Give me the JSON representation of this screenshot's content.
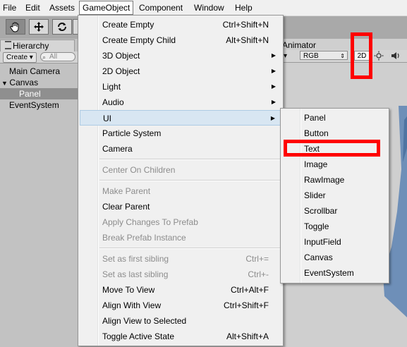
{
  "menubar": {
    "items": [
      {
        "label": "File"
      },
      {
        "label": "Edit"
      },
      {
        "label": "Assets"
      },
      {
        "label": "GameObject"
      },
      {
        "label": "Component"
      },
      {
        "label": "Window"
      },
      {
        "label": "Help"
      }
    ],
    "active": "GameObject"
  },
  "toolbar": {
    "tools": [
      {
        "icon": "hand-icon",
        "active": true
      },
      {
        "icon": "move-icon",
        "active": false
      },
      {
        "icon": "rotate-icon",
        "active": false
      }
    ]
  },
  "hierarchy": {
    "tab_label": "Hierarchy",
    "create_label": "Create ▾",
    "search_placeholder": "All",
    "items": [
      {
        "label": "Main Camera"
      },
      {
        "label": "Canvas"
      },
      {
        "label": "Panel"
      },
      {
        "label": "EventSystem"
      }
    ]
  },
  "scene": {
    "animator_tab": "Animator",
    "render_mode": "RGB",
    "mode_2d": "2D"
  },
  "gameobject_menu": {
    "items": [
      {
        "label": "Create Empty",
        "shortcut": "Ctrl+Shift+N"
      },
      {
        "label": "Create Empty Child",
        "shortcut": "Alt+Shift+N"
      },
      {
        "label": "3D Object",
        "arrow": "▶"
      },
      {
        "label": "2D Object",
        "arrow": "▶"
      },
      {
        "label": "Light",
        "arrow": "▶"
      },
      {
        "label": "Audio",
        "arrow": "▶"
      },
      {
        "label": "UI",
        "arrow": "▶"
      },
      {
        "label": "Particle System"
      },
      {
        "label": "Camera"
      },
      {
        "label": "Center On Children"
      },
      {
        "label": "Make Parent"
      },
      {
        "label": "Clear Parent"
      },
      {
        "label": "Apply Changes To Prefab"
      },
      {
        "label": "Break Prefab Instance"
      },
      {
        "label": "Set as first sibling",
        "shortcut": "Ctrl+="
      },
      {
        "label": "Set as last sibling",
        "shortcut": "Ctrl+-"
      },
      {
        "label": "Move To View",
        "shortcut": "Ctrl+Alt+F"
      },
      {
        "label": "Align With View",
        "shortcut": "Ctrl+Shift+F"
      },
      {
        "label": "Align View to Selected"
      },
      {
        "label": "Toggle Active State",
        "shortcut": "Alt+Shift+A"
      }
    ]
  },
  "ui_submenu": {
    "items": [
      {
        "label": "Panel"
      },
      {
        "label": "Button"
      },
      {
        "label": "Text"
      },
      {
        "label": "Image"
      },
      {
        "label": "RawImage"
      },
      {
        "label": "Slider"
      },
      {
        "label": "Scrollbar"
      },
      {
        "label": "Toggle"
      },
      {
        "label": "InputField"
      },
      {
        "label": "Canvas"
      },
      {
        "label": "EventSystem"
      }
    ]
  },
  "colors": {
    "highlight": "#ff0000",
    "menu_hover": "#d8e6f2"
  }
}
